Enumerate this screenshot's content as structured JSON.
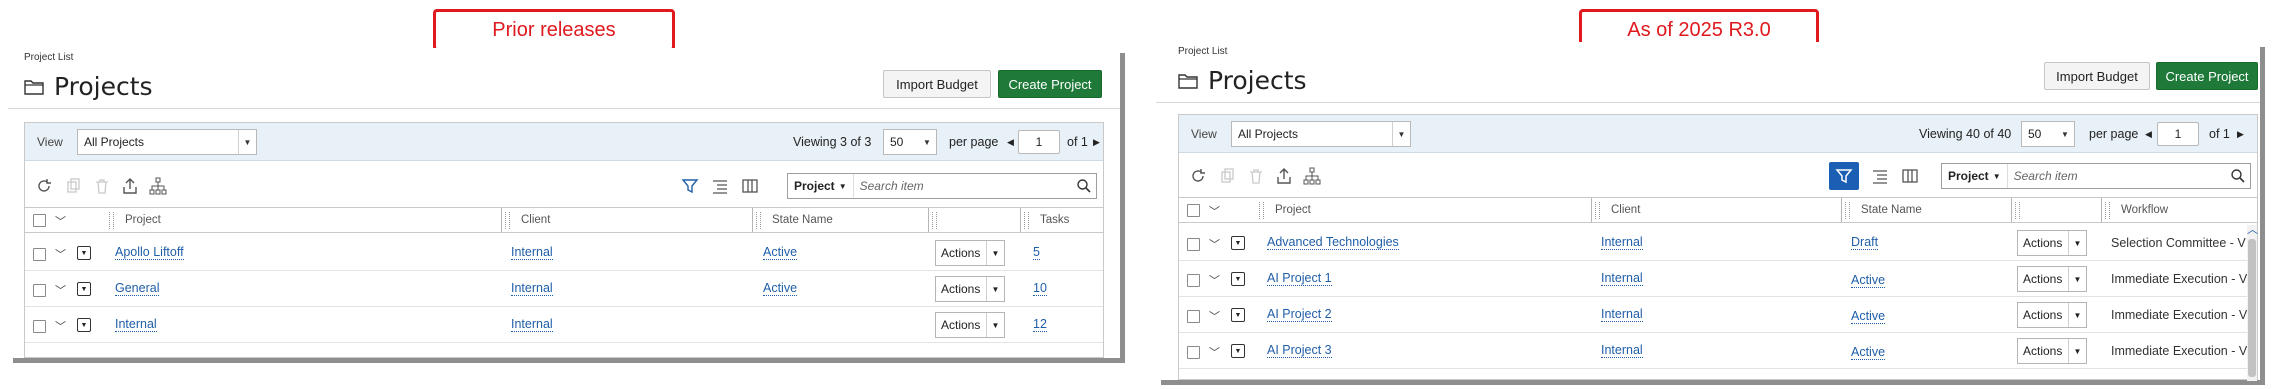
{
  "callouts": {
    "left": "Prior releases",
    "right": "As of 2025 R3.0"
  },
  "left": {
    "breadcrumb": "Project List",
    "title": "Projects",
    "import_budget": "Import Budget",
    "create_project": "Create Project",
    "view_label": "View",
    "view_value": "All Projects",
    "viewing_prefix": "Viewing",
    "viewing_count": "3",
    "viewing_of": "of",
    "viewing_total": "3",
    "per_page_value": "50",
    "per_page_label": "per page",
    "page_value": "1",
    "page_of": "of 1",
    "search_scope": "Project",
    "search_placeholder": "Search item",
    "columns": [
      "Project",
      "Client",
      "State Name",
      "",
      "Tasks"
    ],
    "rows": [
      {
        "project": "Apollo Liftoff",
        "client": "Internal",
        "state": "Active",
        "actions": "Actions",
        "tasks": "5"
      },
      {
        "project": "General",
        "client": "Internal",
        "state": "Active",
        "actions": "Actions",
        "tasks": "10"
      },
      {
        "project": "Internal",
        "client": "Internal",
        "state": "",
        "actions": "Actions",
        "tasks": "12"
      }
    ]
  },
  "right": {
    "breadcrumb": "Project List",
    "title": "Projects",
    "import_budget": "Import Budget",
    "create_project": "Create Project",
    "view_label": "View",
    "view_value": "All Projects",
    "viewing_prefix": "Viewing",
    "viewing_count": "40",
    "viewing_of": "of",
    "viewing_total": "40",
    "per_page_value": "50",
    "per_page_label": "per page",
    "page_value": "1",
    "page_of": "of 1",
    "search_scope": "Project",
    "search_placeholder": "Search item",
    "columns": [
      "Project",
      "Client",
      "State Name",
      "",
      "Workflow"
    ],
    "rows": [
      {
        "project": "Advanced Technologies",
        "client": "Internal",
        "state": "Draft",
        "actions": "Actions",
        "workflow": "Selection Committee - V"
      },
      {
        "project": "AI Project 1",
        "client": "Internal",
        "state": "Active",
        "actions": "Actions",
        "workflow": "Immediate Execution - V"
      },
      {
        "project": "AI Project 2",
        "client": "Internal",
        "state": "Active",
        "actions": "Actions",
        "workflow": "Immediate Execution - V"
      },
      {
        "project": "AI Project 3",
        "client": "Internal",
        "state": "Active",
        "actions": "Actions",
        "workflow": "Immediate Execution - V"
      }
    ]
  },
  "colors": {
    "primary_button": "#1f7a3a",
    "link": "#1f5ea8",
    "callout": "#e0191f",
    "filter_active": "#1a5fb4"
  }
}
